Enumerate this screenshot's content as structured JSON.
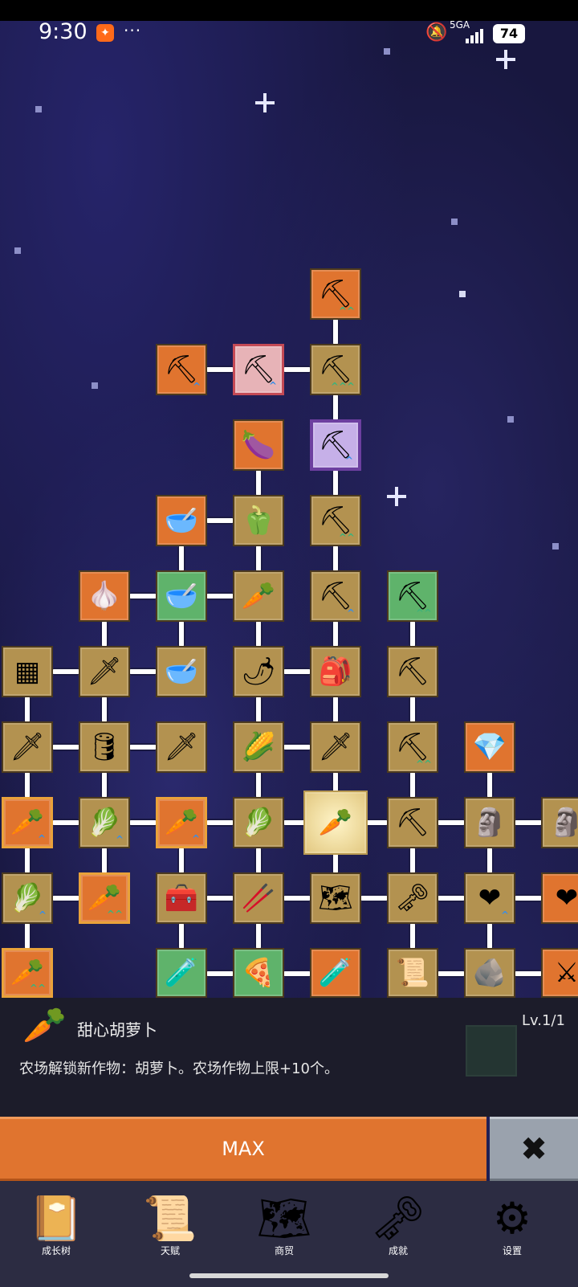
{
  "status_bar": {
    "time": "9:30",
    "app_icon": "app-notification-icon",
    "more": "···",
    "network": "5GA",
    "battery": "74"
  },
  "tree": {
    "nodes": [
      {
        "icon": "shovel-icon",
        "color": "orange",
        "glyph": "⛏",
        "up": "^^"
      },
      {
        "icon": "shovel-icon",
        "color": "orange",
        "glyph": "⛏",
        "up": "^"
      },
      {
        "icon": "shovel-icon",
        "color": "pink",
        "glyph": "⛏",
        "up": "^"
      },
      {
        "icon": "shovel-icon",
        "color": "tan",
        "glyph": "⛏",
        "up": "^^^"
      },
      {
        "icon": "eggplant-icon",
        "color": "orange",
        "glyph": "🍆",
        "up": ""
      },
      {
        "icon": "shovel-icon",
        "color": "purple",
        "glyph": "⛏",
        "up": "^"
      },
      {
        "icon": "bowl-icon",
        "color": "orange",
        "glyph": "🥣",
        "up": ""
      },
      {
        "icon": "pepper-icon",
        "color": "tan",
        "glyph": "🫑",
        "up": ""
      },
      {
        "icon": "shovel-icon",
        "color": "tan",
        "glyph": "⛏",
        "up": "^^"
      },
      {
        "icon": "garlic-icon",
        "color": "orange",
        "glyph": "🧄",
        "up": ""
      },
      {
        "icon": "soup-bowl-icon",
        "color": "green",
        "glyph": "🥣",
        "up": ""
      },
      {
        "icon": "radish-icon",
        "color": "tan",
        "glyph": "🥕",
        "up": ""
      },
      {
        "icon": "shovel-icon",
        "color": "tan",
        "glyph": "⛏",
        "up": "^"
      },
      {
        "icon": "pickaxe-icon",
        "color": "green",
        "glyph": "⛏",
        "up": "^^"
      },
      {
        "icon": "crate-icon",
        "color": "tan",
        "glyph": "▦",
        "up": ""
      },
      {
        "icon": "golden-sword-icon",
        "color": "tan",
        "glyph": "🗡",
        "up": ""
      },
      {
        "icon": "bowl-icon",
        "color": "tan",
        "glyph": "🥣",
        "up": ""
      },
      {
        "icon": "chili-icon",
        "color": "tan",
        "glyph": "🌶",
        "up": ""
      },
      {
        "icon": "backpack-icon",
        "color": "tan",
        "glyph": "🎒",
        "up": ""
      },
      {
        "icon": "pickaxe-icon",
        "color": "tan",
        "glyph": "⛏",
        "up": ""
      },
      {
        "icon": "sword-icon",
        "color": "tan",
        "glyph": "🗡",
        "up": ""
      },
      {
        "icon": "barrel-icon",
        "color": "tan",
        "glyph": "🛢",
        "up": ""
      },
      {
        "icon": "sword-icon",
        "color": "tan",
        "glyph": "🗡",
        "up": ""
      },
      {
        "icon": "corn-icon",
        "color": "tan",
        "glyph": "🌽",
        "up": ""
      },
      {
        "icon": "dagger-icon",
        "color": "tan",
        "glyph": "🗡",
        "up": ""
      },
      {
        "icon": "pickaxe-icon",
        "color": "tan",
        "glyph": "⛏",
        "up": "^^"
      },
      {
        "icon": "crystal-icon",
        "color": "orange",
        "glyph": "💎",
        "up": ""
      },
      {
        "icon": "carrot-icon",
        "color": "orange-gold",
        "glyph": "🥕",
        "up": "^"
      },
      {
        "icon": "cabbage-icon",
        "color": "tan",
        "glyph": "🥬",
        "up": "^"
      },
      {
        "icon": "carrot-icon",
        "color": "orange-gold",
        "glyph": "🥕",
        "up": "^"
      },
      {
        "icon": "cabbage-icon",
        "color": "tan",
        "glyph": "🥬",
        "up": ""
      },
      {
        "icon": "carrot-icon",
        "color": "selected",
        "glyph": "🥕",
        "up": ""
      },
      {
        "icon": "pickaxe-icon",
        "color": "tan",
        "glyph": "⛏",
        "up": ""
      },
      {
        "icon": "statue-icon",
        "color": "tan",
        "glyph": "🗿",
        "up": ""
      },
      {
        "icon": "statue-icon",
        "color": "tan",
        "glyph": "🗿",
        "up": ""
      },
      {
        "icon": "cabbage-icon",
        "color": "tan",
        "glyph": "🥬",
        "up": "^"
      },
      {
        "icon": "carrot-icon",
        "color": "orange-gold",
        "glyph": "🥕",
        "up": "^^"
      },
      {
        "icon": "treasure-chest-icon",
        "color": "tan",
        "glyph": "🧰",
        "up": ""
      },
      {
        "icon": "leek-icon",
        "color": "tan",
        "glyph": "🥢",
        "up": ""
      },
      {
        "icon": "map-icon",
        "color": "tan",
        "glyph": "🗺",
        "up": ""
      },
      {
        "icon": "key-icon",
        "color": "tan",
        "glyph": "🗝",
        "up": ""
      },
      {
        "icon": "heart-icon",
        "color": "tan",
        "glyph": "❤",
        "up": "^"
      },
      {
        "icon": "heart-icon",
        "color": "orange",
        "glyph": "❤",
        "up": ""
      },
      {
        "icon": "carrot-icon",
        "color": "orange-gold",
        "glyph": "🥕",
        "up": "^^"
      },
      {
        "icon": "potion-icon",
        "color": "green",
        "glyph": "🧪",
        "up": ""
      },
      {
        "icon": "pizza-icon",
        "color": "green",
        "glyph": "🍕",
        "up": ""
      },
      {
        "icon": "potion-icon",
        "color": "orange",
        "glyph": "🧪",
        "up": ""
      },
      {
        "icon": "scroll-icon",
        "color": "tan",
        "glyph": "📜",
        "up": ""
      },
      {
        "icon": "stone-icon",
        "color": "tan",
        "glyph": "🪨",
        "up": ""
      },
      {
        "icon": "crossed-swords-icon",
        "color": "orange",
        "glyph": "⚔",
        "up": ""
      }
    ]
  },
  "detail": {
    "icon": "carrot-icon",
    "title": "甜心胡萝卜",
    "level": "Lv.1/1",
    "description": "农场解锁新作物：胡萝卜。农场作物上限+10个。",
    "max_label": "MAX",
    "close_glyph": "✖"
  },
  "nav": {
    "items": [
      {
        "label": "成长树",
        "icon": "book-icon",
        "glyph": "📔"
      },
      {
        "label": "天赋",
        "icon": "scroll-icon",
        "glyph": "📜"
      },
      {
        "label": "商贸",
        "icon": "map-icon",
        "glyph": "🗺"
      },
      {
        "label": "成就",
        "icon": "key-icon",
        "glyph": "🗝"
      },
      {
        "label": "设置",
        "icon": "gear-icon",
        "glyph": "⚙"
      }
    ]
  }
}
